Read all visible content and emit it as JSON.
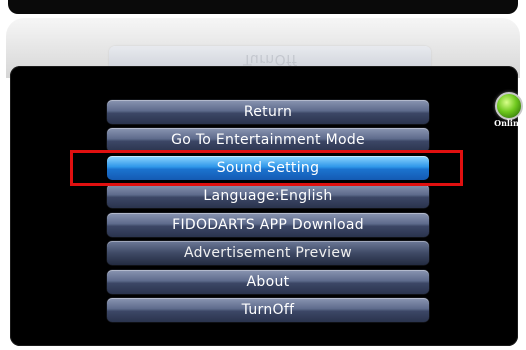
{
  "reflection": {
    "text": "TurnOff"
  },
  "badge": {
    "label": "Online",
    "icon": "globe-icon",
    "color": "#6fc81e"
  },
  "menu": {
    "items": [
      {
        "label": "Return",
        "state": "normal"
      },
      {
        "label": "Go To Entertainment Mode",
        "state": "normal"
      },
      {
        "label": "Sound Setting",
        "state": "selected"
      },
      {
        "label": "Language:English",
        "state": "normal"
      },
      {
        "label": "FIDODARTS APP Download",
        "state": "normal"
      },
      {
        "label": "Advertisement Preview",
        "state": "dim"
      },
      {
        "label": "About",
        "state": "normal"
      },
      {
        "label": "TurnOff",
        "state": "normal"
      }
    ]
  },
  "colors": {
    "highlight": "#e01010",
    "selected": "#2f97e9"
  }
}
